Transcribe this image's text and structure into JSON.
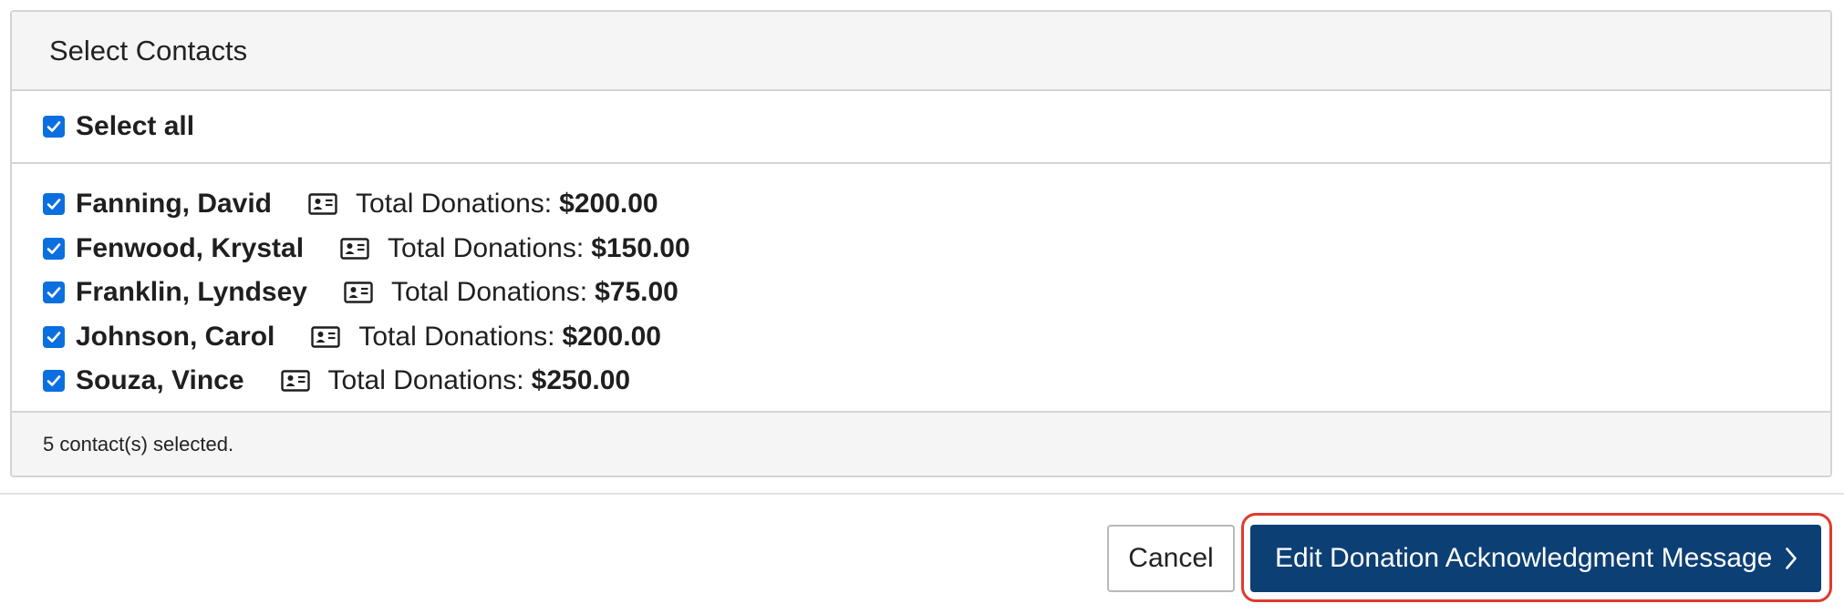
{
  "panel": {
    "title": "Select Contacts",
    "select_all_label": "Select all",
    "select_all_checked": true,
    "contacts": [
      {
        "name": "Fanning, David",
        "total_label": "Total Donations:",
        "amount": "$200.00",
        "checked": true
      },
      {
        "name": "Fenwood, Krystal",
        "total_label": "Total Donations:",
        "amount": "$150.00",
        "checked": true
      },
      {
        "name": "Franklin, Lyndsey",
        "total_label": "Total Donations:",
        "amount": "$75.00",
        "checked": true
      },
      {
        "name": "Johnson, Carol",
        "total_label": "Total Donations:",
        "amount": "$200.00",
        "checked": true
      },
      {
        "name": "Souza, Vince",
        "total_label": "Total Donations:",
        "amount": "$250.00",
        "checked": true
      }
    ],
    "footer_text": "5 contact(s) selected."
  },
  "actions": {
    "cancel_label": "Cancel",
    "primary_label": "Edit Donation Acknowledgment Message"
  },
  "icons": {
    "checkbox": "checkbox-checked-icon",
    "contact_card": "contact-card-icon",
    "chevron": "chevron-right-icon"
  },
  "colors": {
    "checkbox": "#0b6fe0",
    "primary_button": "#0c3f74",
    "highlight": "#e03a2f",
    "header_bg": "#f5f5f5",
    "border": "#d4d4d4"
  }
}
